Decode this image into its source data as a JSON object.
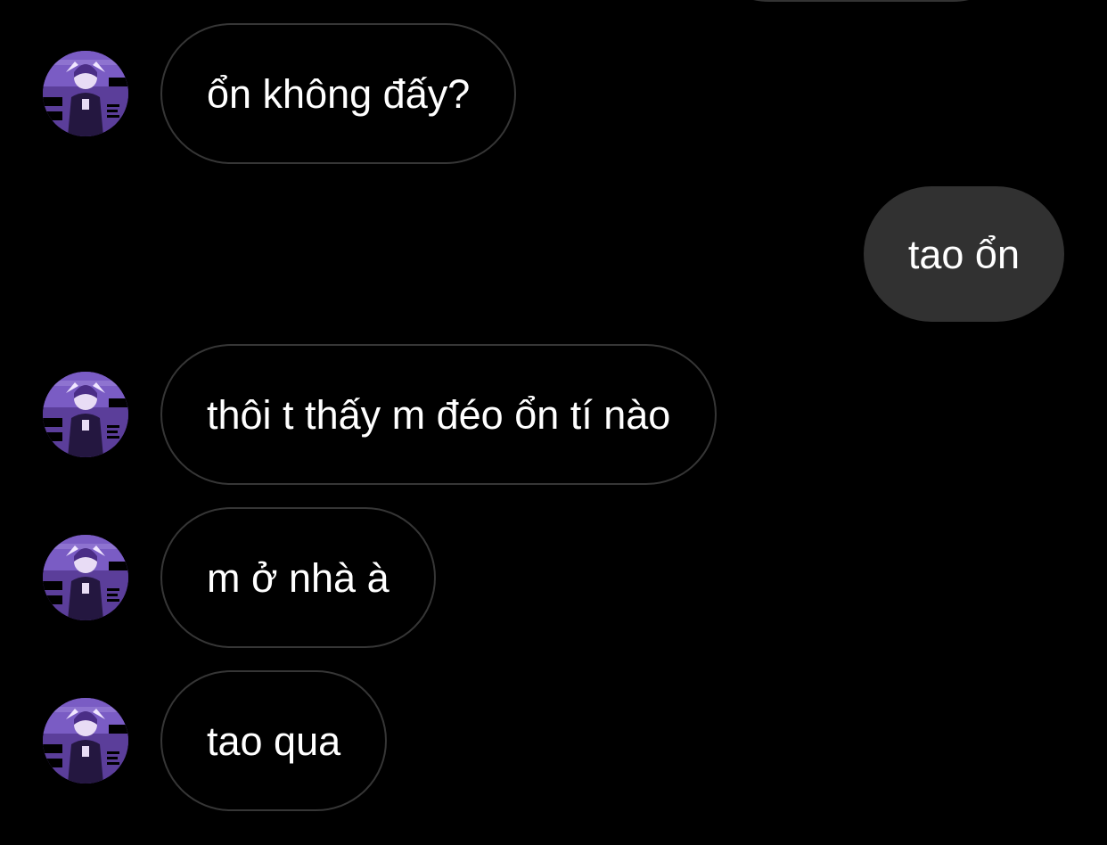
{
  "conversation": {
    "messages": [
      {
        "direction": "incoming",
        "text": "ổn không đấy?"
      },
      {
        "direction": "outgoing",
        "text": "tao ổn"
      },
      {
        "direction": "incoming",
        "text": "thôi t thấy m đéo ổn tí nào"
      },
      {
        "direction": "incoming",
        "text": "m ở nhà à"
      },
      {
        "direction": "incoming",
        "text": "tao qua"
      }
    ]
  },
  "theme": {
    "background": "#000000",
    "incoming_bubble_border": "#363636",
    "outgoing_bubble_fill": "#313131",
    "text": "#ffffff",
    "avatar_accent": "#6a4bb0"
  },
  "icons": {
    "avatar": "anime-character-avatar"
  }
}
